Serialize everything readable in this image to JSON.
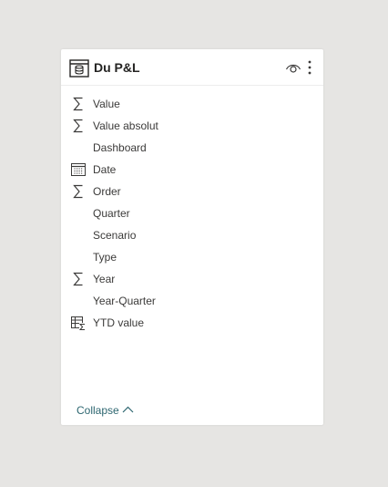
{
  "table": {
    "title": "Du P&L",
    "icon": "table-icon"
  },
  "header_actions": {
    "visibility_icon": "eye-icon",
    "more_icon": "more-options-icon"
  },
  "fields": [
    {
      "label": "Value",
      "icon": "sigma-icon"
    },
    {
      "label": "Value absolut",
      "icon": "sigma-icon"
    },
    {
      "label": "Dashboard",
      "icon": ""
    },
    {
      "label": "Date",
      "icon": "calendar-icon"
    },
    {
      "label": "Order",
      "icon": "sigma-icon"
    },
    {
      "label": "Quarter",
      "icon": ""
    },
    {
      "label": "Scenario",
      "icon": ""
    },
    {
      "label": "Type",
      "icon": ""
    },
    {
      "label": "Year",
      "icon": "sigma-icon"
    },
    {
      "label": "Year-Quarter",
      "icon": ""
    },
    {
      "label": "YTD value",
      "icon": "measure-icon"
    }
  ],
  "footer": {
    "collapse_label": "Collapse"
  },
  "colors": {
    "background": "#e6e5e3",
    "card": "#ffffff",
    "link": "#2d6670",
    "text": "#3b3a39"
  }
}
